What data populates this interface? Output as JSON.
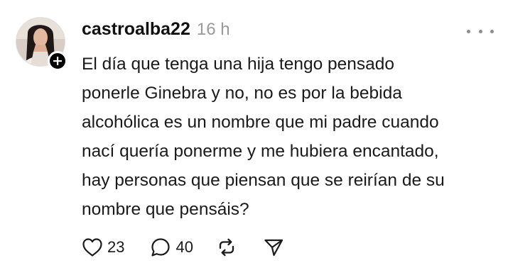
{
  "post": {
    "username": "castroalba22",
    "timestamp": "16 h",
    "body_lines": [
      "El día que tenga una hija tengo pensado",
      "ponerle Ginebra y no, no es por la bebida",
      "alcohólica es un nombre que mi padre cuando",
      "nací quería ponerme y me hubiera encantado,",
      "hay personas que piensan que se reirían de su",
      "nombre que pensáis?"
    ],
    "actions": {
      "like_count": "23",
      "reply_count": "40"
    },
    "icons": {
      "more": "more-options-icon",
      "follow": "plus-icon",
      "like": "heart-icon",
      "reply": "comment-bubble-icon",
      "repost": "repost-icon",
      "share": "send-icon"
    }
  }
}
